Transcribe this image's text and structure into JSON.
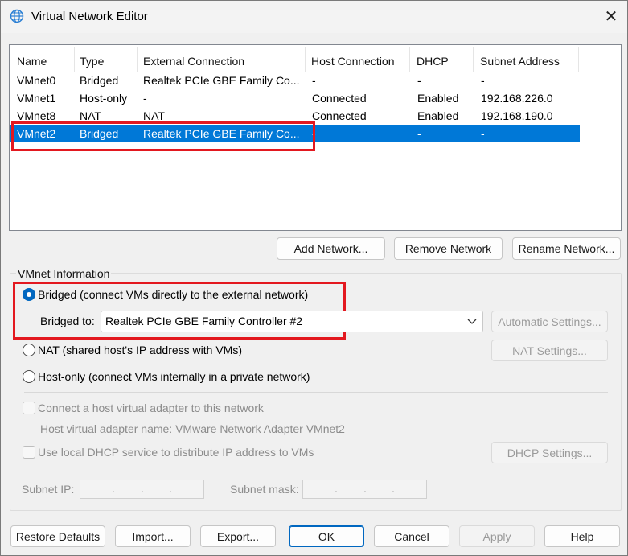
{
  "window": {
    "title": "Virtual Network Editor",
    "icon": "globe-network-icon"
  },
  "list": {
    "columns": [
      "Name",
      "Type",
      "External Connection",
      "Host Connection",
      "DHCP",
      "Subnet Address"
    ],
    "rows": [
      {
        "name": "VMnet0",
        "type": "Bridged",
        "external": "Realtek PCIe GBE Family Co...",
        "host": "-",
        "dhcp": "-",
        "subnet": "-"
      },
      {
        "name": "VMnet1",
        "type": "Host-only",
        "external": "-",
        "host": "Connected",
        "dhcp": "Enabled",
        "subnet": "192.168.226.0"
      },
      {
        "name": "VMnet8",
        "type": "NAT",
        "external": "NAT",
        "host": "Connected",
        "dhcp": "Enabled",
        "subnet": "192.168.190.0"
      },
      {
        "name": "VMnet2",
        "type": "Bridged",
        "external": "Realtek PCIe GBE Family Co...",
        "host": "-",
        "dhcp": "-",
        "subnet": "-"
      }
    ],
    "selected_row": "VMnet2"
  },
  "list_buttons": {
    "add": "Add Network...",
    "remove": "Remove Network",
    "rename": "Rename Network..."
  },
  "info": {
    "group_label": "VMnet Information",
    "bridged_label": "Bridged (connect VMs directly to the external network)",
    "bridged_to_label": "Bridged to:",
    "bridged_to_value": "Realtek PCIe GBE Family Controller #2",
    "automatic_settings": "Automatic Settings...",
    "nat_label": "NAT (shared host's IP address with VMs)",
    "nat_settings": "NAT Settings...",
    "hostonly_label": "Host-only (connect VMs internally in a private network)",
    "connect_adapter_label": "Connect a host virtual adapter to this network",
    "adapter_name_label": "Host virtual adapter name: VMware Network Adapter VMnet2",
    "dhcp_label": "Use local DHCP service to distribute IP address to VMs",
    "dhcp_settings": "DHCP Settings...",
    "subnet_ip_label": "Subnet IP:",
    "subnet_mask_label": "Subnet mask:",
    "selected_mode": "bridged"
  },
  "footer": {
    "restore": "Restore Defaults",
    "import": "Import...",
    "export": "Export...",
    "ok": "OK",
    "cancel": "Cancel",
    "apply": "Apply",
    "help": "Help"
  },
  "colors": {
    "selection": "#0078d7",
    "highlight_box": "#e3181f",
    "accent": "#0067c0"
  }
}
